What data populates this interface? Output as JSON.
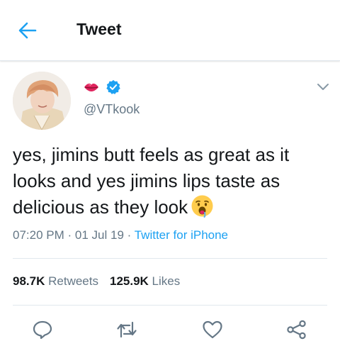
{
  "header": {
    "title": "Tweet",
    "back_icon": "arrow-left-icon"
  },
  "colors": {
    "accent": "#1da1f2",
    "secondary_text": "#657786",
    "primary_text": "#14171a",
    "divider": "#e1e8ed"
  },
  "tweet": {
    "display_name_icons": [
      "lips-emoji-icon",
      "verified-badge-icon"
    ],
    "username": "@VTkook",
    "text": "yes, jimins butt feels as great as it looks and yes jimins lips taste as delicious as they look",
    "text_emoji": "drooling-face-emoji-icon",
    "time": "07:20 PM",
    "date": "01 Jul 19",
    "source": "Twitter for iPhone",
    "separator": "·"
  },
  "stats": {
    "retweets_count": "98.7K",
    "retweets_label": "Retweets",
    "likes_count": "125.9K",
    "likes_label": "Likes"
  },
  "actions": [
    "reply-icon",
    "retweet-icon",
    "like-icon",
    "share-icon"
  ]
}
